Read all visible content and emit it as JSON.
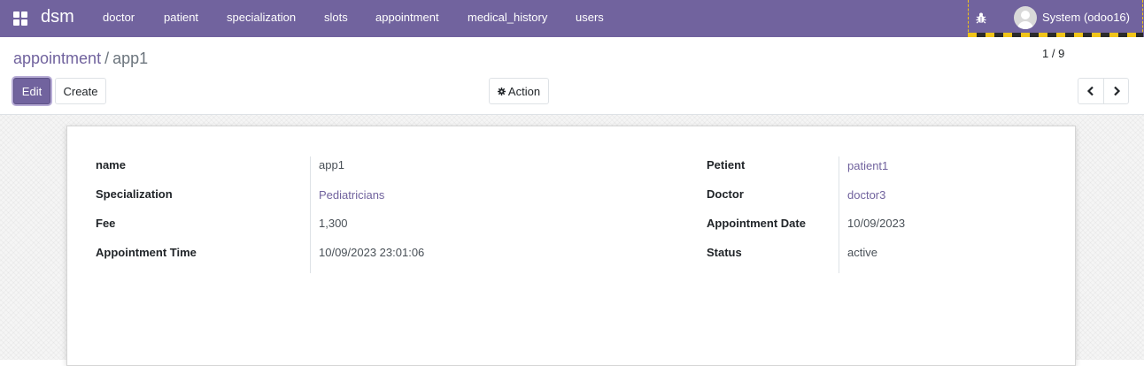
{
  "navbar": {
    "brand": "dsm",
    "menu": [
      "doctor",
      "patient",
      "specialization",
      "slots",
      "appointment",
      "medical_history",
      "users"
    ],
    "user": "System (odoo16)",
    "accent": "#71639e"
  },
  "breadcrumb": {
    "parent": "appointment",
    "separator": "/",
    "current": "app1"
  },
  "buttons": {
    "edit": "Edit",
    "create": "Create",
    "action": "Action"
  },
  "pager": {
    "value": "1 / 9"
  },
  "form": {
    "left": [
      {
        "label": "name",
        "value": "app1"
      },
      {
        "label": "Specialization",
        "value": "Pediatricians"
      },
      {
        "label": "Fee",
        "value": "1,300"
      },
      {
        "label": "Appointment Time",
        "value": "10/09/2023 23:01:06"
      }
    ],
    "right": [
      {
        "label": "Petient",
        "value": "patient1"
      },
      {
        "label": "Doctor",
        "value": "doctor3"
      },
      {
        "label": "Appointment Date",
        "value": "10/09/2023"
      },
      {
        "label": "Status",
        "value": "active"
      }
    ]
  }
}
